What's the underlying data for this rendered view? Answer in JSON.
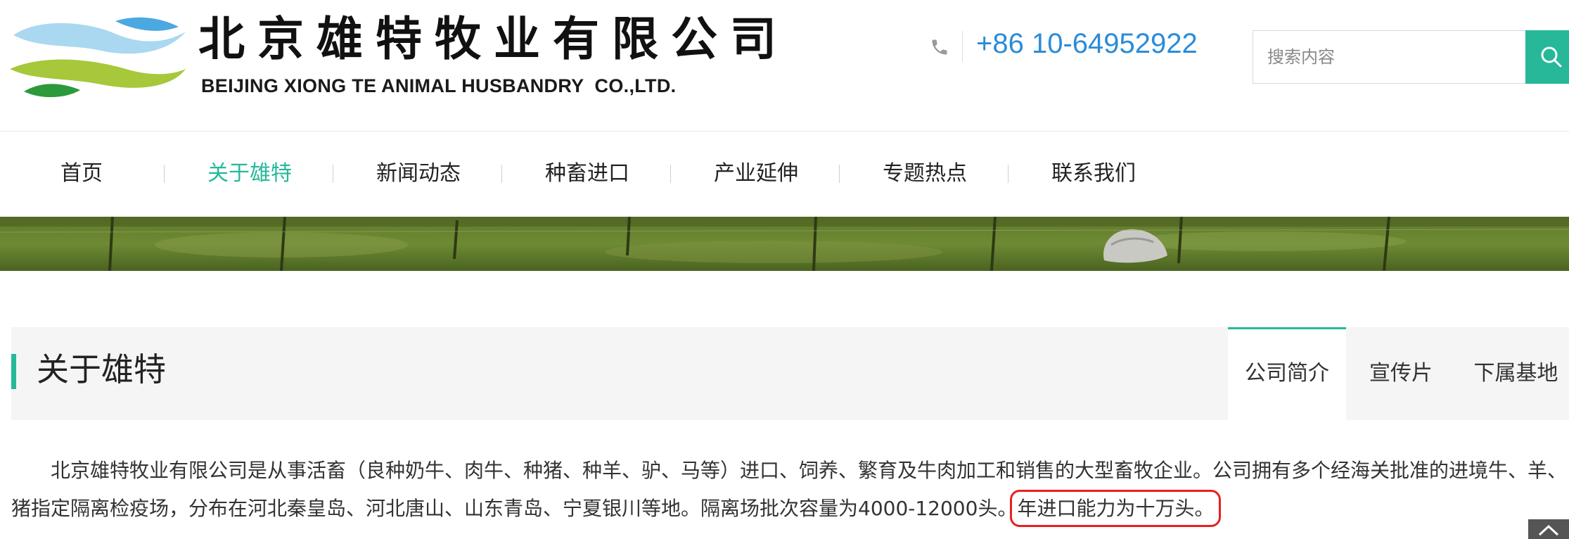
{
  "header": {
    "logo_cn": "北京雄特牧业有限公司",
    "logo_en": "BEIJING XIONG TE ANIMAL HUSBANDRY  CO.,LTD.",
    "phone": "+86 10-64952922",
    "search": {
      "placeholder": "搜索内容",
      "button_icon": "search-icon"
    }
  },
  "nav": {
    "items": [
      {
        "label": "首页",
        "active": false
      },
      {
        "label": "关于雄特",
        "active": true
      },
      {
        "label": "新闻动态",
        "active": false
      },
      {
        "label": "种畜进口",
        "active": false
      },
      {
        "label": "产业延伸",
        "active": false
      },
      {
        "label": "专题热点",
        "active": false
      },
      {
        "label": "联系我们",
        "active": false
      }
    ]
  },
  "section": {
    "title": "关于雄特",
    "tabs": [
      {
        "label": "公司简介",
        "active": true
      },
      {
        "label": "宣传片",
        "active": false
      },
      {
        "label": "下属基地",
        "active": false
      }
    ]
  },
  "content": {
    "line1": "北京雄特牧业有限公司是从事活畜（良种奶牛、肉牛、种猪、种羊、驴、马等）进口、饲养、繁育及牛肉加工和销售的大型畜牧企业。公司拥有多个经海关批准的进境牛、羊、",
    "line2_pre": "猪指定隔离检疫场，分布在河北秦皇岛、河北唐山、山东青岛、宁夏银川等地。隔离场批次容量为4000-12000头。",
    "line2_highlight": "年进口能力为十万头。"
  },
  "colors": {
    "accent": "#26b899",
    "phone": "#2a8cd8",
    "highlight_border": "#e82020",
    "section_bg": "#f5f5f5"
  },
  "icons": [
    "phone-icon",
    "search-icon",
    "back-to-top-icon"
  ]
}
